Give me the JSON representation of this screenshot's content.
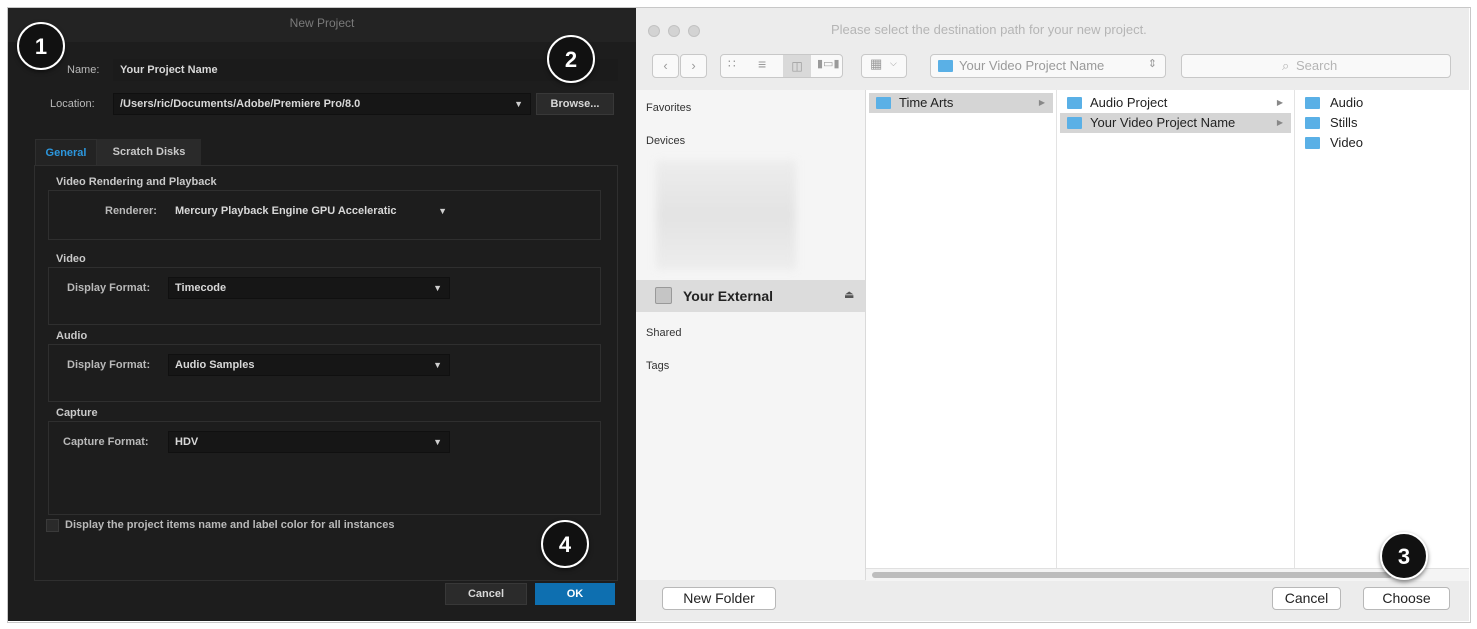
{
  "premiere": {
    "title": "New Project",
    "name_label": "Name:",
    "name_value": "Your Project Name",
    "location_label": "Location:",
    "location_value": "/Users/ric/Documents/Adobe/Premiere Pro/8.0",
    "browse_label": "Browse...",
    "tabs": [
      "General",
      "Scratch Disks"
    ],
    "group_video_rendering": "Video Rendering and Playback",
    "renderer_label": "Renderer:",
    "renderer_value": "Mercury Playback Engine GPU Acceleratic",
    "group_video": "Video",
    "video_display_label": "Display Format:",
    "video_display_value": "Timecode",
    "group_audio": "Audio",
    "audio_display_label": "Display Format:",
    "audio_display_value": "Audio Samples",
    "group_capture": "Capture",
    "capture_label": "Capture Format:",
    "capture_value": "HDV",
    "checkbox_label": "Display the project items name and label color for all instances",
    "cancel_label": "Cancel",
    "ok_label": "OK"
  },
  "badges": [
    "1",
    "2",
    "3",
    "4"
  ],
  "finder": {
    "title": "Please select the destination path for your new project.",
    "path_popup": "Your Video Project Name",
    "search_placeholder": "Search",
    "sidebar": {
      "favorites": "Favorites",
      "devices": "Devices",
      "external": "Your External",
      "shared": "Shared",
      "tags": "Tags"
    },
    "col1": [
      "Time Arts"
    ],
    "col2": [
      "Audio Project",
      "Your Video Project Name"
    ],
    "col3": [
      "Audio",
      "Stills",
      "Video"
    ],
    "new_folder_label": "New Folder",
    "cancel_label": "Cancel",
    "choose_label": "Choose"
  },
  "colors": {
    "accent_blue": "#0e6fb0",
    "folder_blue": "#5ab0e6",
    "premiere_bg": "#1d1d1d"
  }
}
